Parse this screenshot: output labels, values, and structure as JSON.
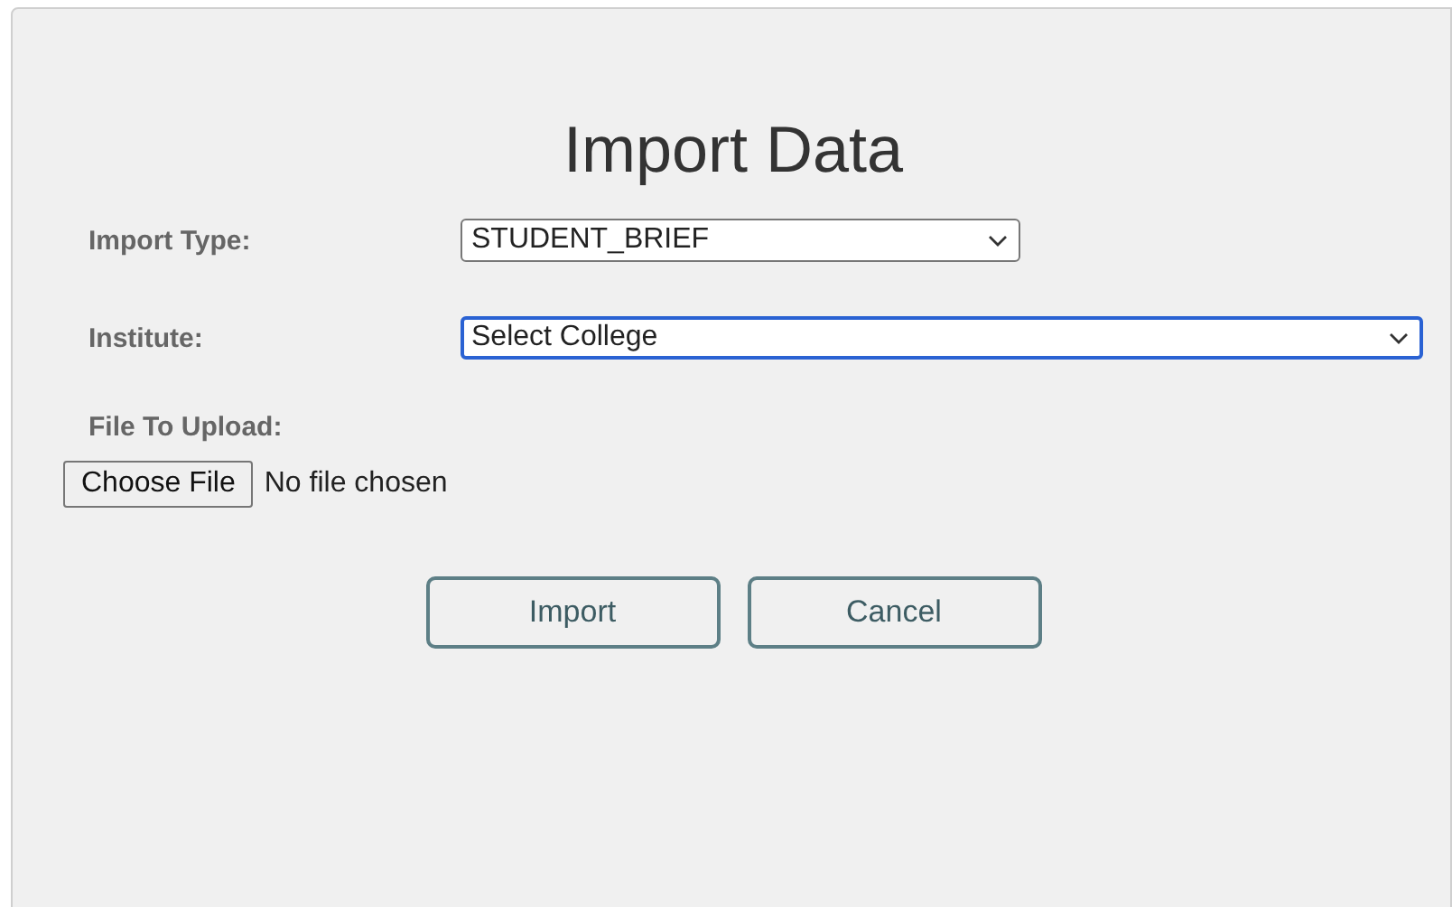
{
  "title": "Import Data",
  "fields": [
    {
      "label": "Import Type:",
      "value": "STUDENT_BRIEF",
      "focused": false,
      "wide": false
    },
    {
      "label": "Institute:",
      "value": "Select College",
      "focused": true,
      "wide": true
    }
  ],
  "file": {
    "label": "File To Upload:",
    "button": "Choose File",
    "status": "No file chosen"
  },
  "buttons": [
    "Import",
    "Cancel"
  ]
}
